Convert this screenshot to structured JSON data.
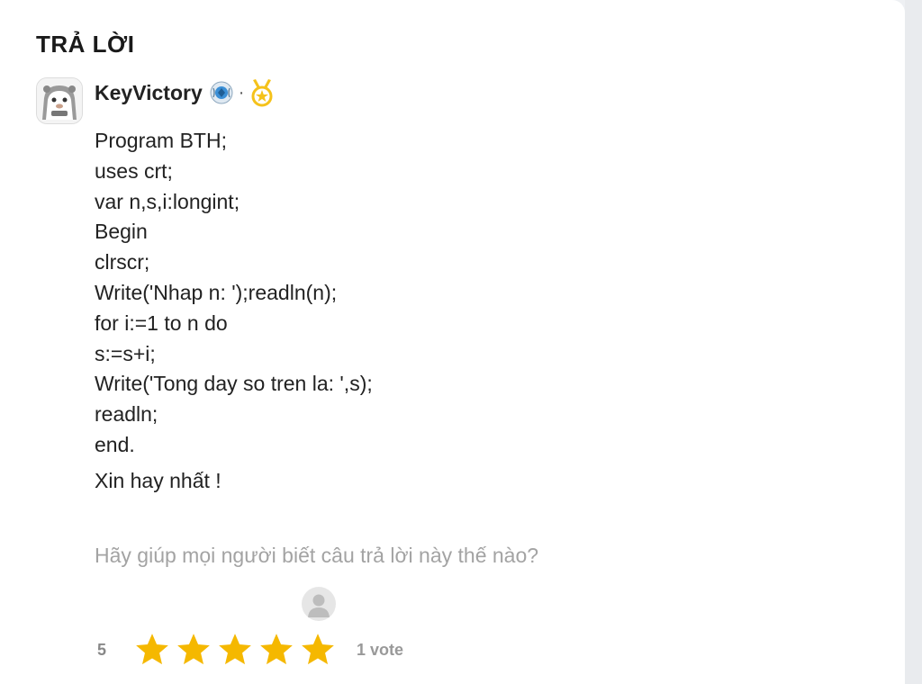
{
  "section": {
    "title": "TRẢ LỜI"
  },
  "answer": {
    "author": {
      "name": "KeyVictory",
      "separator": "·",
      "badge_icons": [
        "rank-badge-icon",
        "medal-icon"
      ]
    },
    "code_lines": [
      "Program BTH;",
      "uses crt;",
      "var n,s,i:longint;",
      "Begin",
      "clrscr;",
      "Write('Nhap n: ');readln(n);",
      "for i:=1 to n do",
      "s:=s+i;",
      "Write('Tong day so tren la: ',s);",
      "readln;",
      "end."
    ],
    "closing": "Xin hay nhất !"
  },
  "feedback": {
    "prompt": "Hãy giúp mọi người biết câu trả lời này thế nào?",
    "rating_value": "5",
    "stars_filled": 5,
    "stars_total": 5,
    "vote_count": "1 vote"
  },
  "colors": {
    "star": "#f5b800",
    "badge_blue": "#3b8fd6",
    "medal_gold": "#f5c21a",
    "prompt_gray": "#a3a3a3"
  }
}
